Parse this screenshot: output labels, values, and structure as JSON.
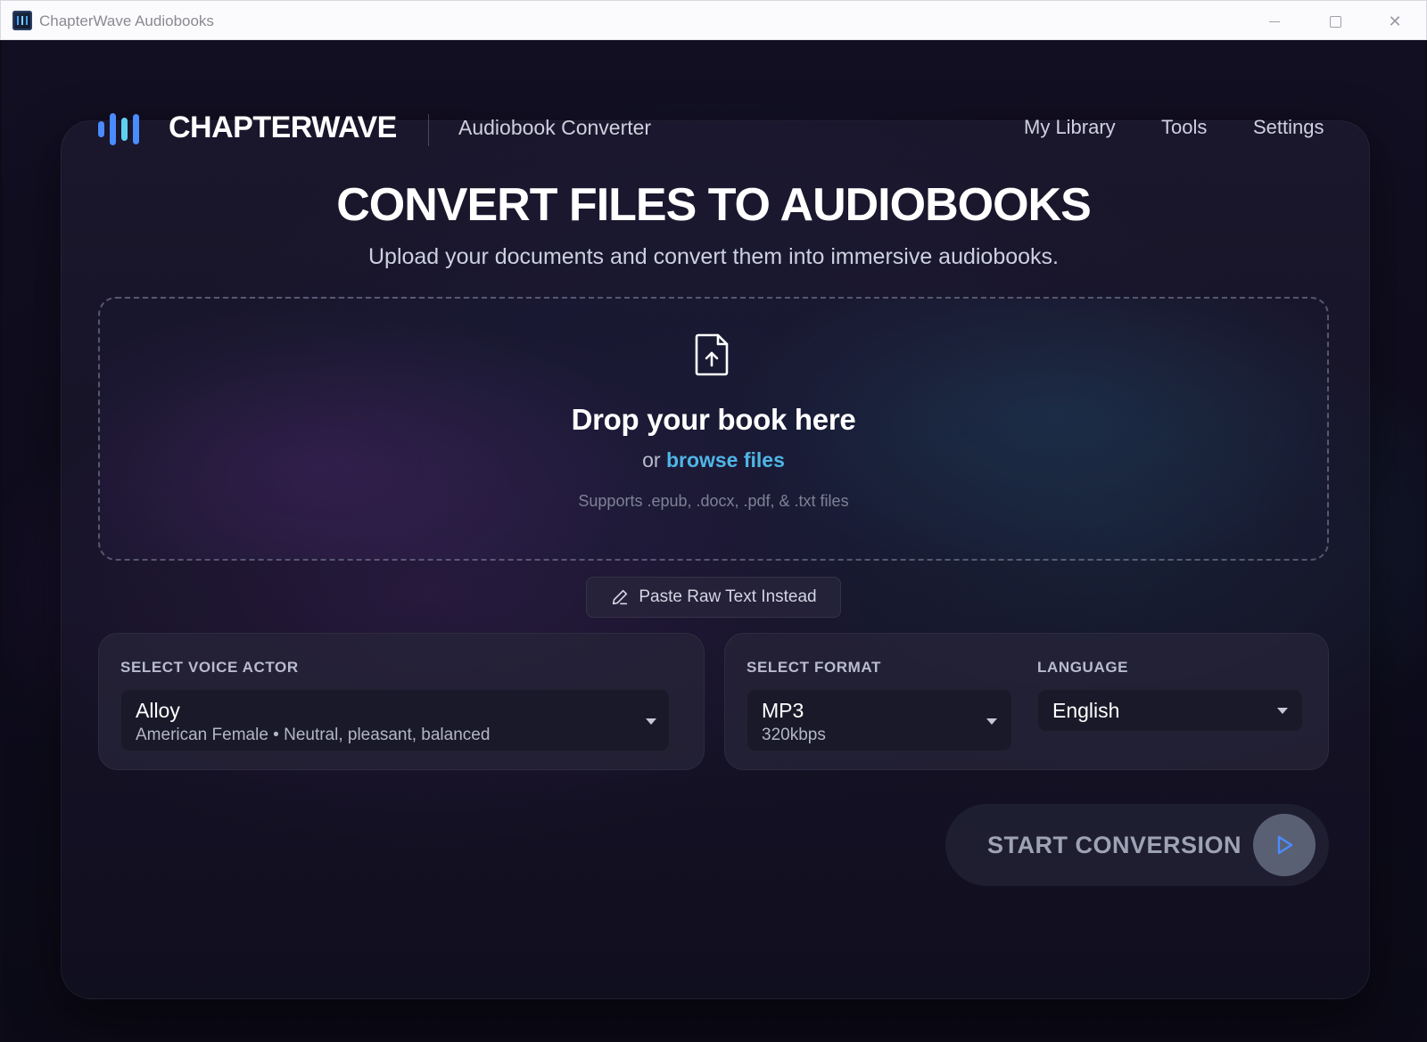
{
  "window": {
    "title": "ChapterWave Audiobooks"
  },
  "header": {
    "brand": "CHAPTERWAVE",
    "subtitle": "Audiobook Converter",
    "nav": [
      "My Library",
      "Tools",
      "Settings"
    ]
  },
  "hero": {
    "title": "CONVERT FILES TO AUDIOBOOKS",
    "subtitle": "Upload your documents and convert them into immersive audiobooks."
  },
  "dropzone": {
    "title": "Drop your book here",
    "or_text": "or",
    "browse_label": "browse files",
    "supports": "Supports .epub, .docx, .pdf, & .txt files"
  },
  "paste_button": {
    "label": "Paste Raw Text Instead"
  },
  "voice": {
    "label": "SELECT VOICE ACTOR",
    "selected_name": "Alloy",
    "selected_desc": "American Female • Neutral, pleasant, balanced"
  },
  "format": {
    "label": "SELECT FORMAT",
    "selected": "MP3",
    "bitrate": "320kbps"
  },
  "language": {
    "label": "LANGUAGE",
    "selected": "English"
  },
  "start_button": {
    "label": "START CONVERSION"
  },
  "colors": {
    "accent_link": "#4fb6e6",
    "logo_blue": "#4a8cff",
    "logo_cyan": "#5fd0f0",
    "background": "#0e0c1c"
  },
  "icons": {
    "logo": "sound-wave-icon",
    "upload": "file-upload-icon",
    "paste": "pencil-icon",
    "dropdown": "chevron-down-icon",
    "play": "play-icon"
  }
}
